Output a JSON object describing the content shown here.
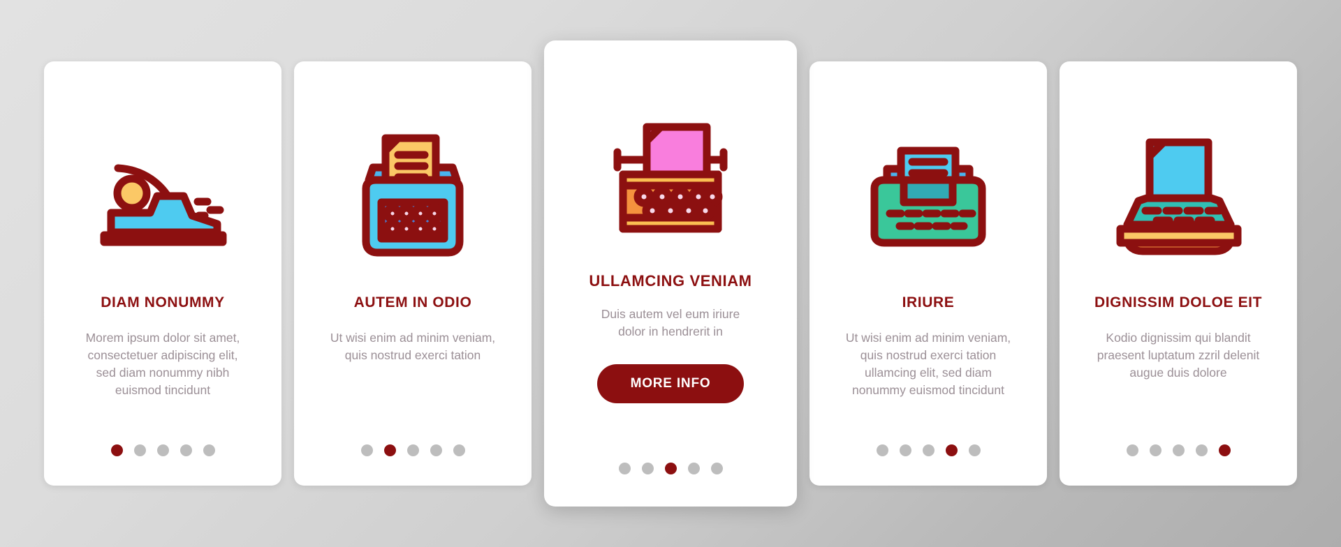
{
  "theme": {
    "accent": "#8c0f10",
    "card_background": "#ffffff",
    "body_text": "#9b8f96",
    "dot_inactive": "#bdbdbd",
    "dot_active": "#8c0f10",
    "background_light": "#e2e2e2",
    "background_dark": "#adadad"
  },
  "carousel": {
    "total_slides": 5,
    "cards": [
      {
        "icon_name": "typewriter-carriage-icon",
        "title": "DIAM NONUMMY",
        "body": "Morem ipsum dolor sit amet, consectetuer adipiscing elit, sed diam nonummy nibh euismod tincidunt",
        "active_dot": 1,
        "featured": false,
        "button_label": ""
      },
      {
        "icon_name": "typewriter-paper-keys-icon",
        "title": "AUTEM IN ODIO",
        "body": "Ut wisi enim ad minim veniam, quis nostrud exerci tation",
        "active_dot": 2,
        "featured": false,
        "button_label": ""
      },
      {
        "icon_name": "typewriter-pink-paper-icon",
        "title": "ULLAMCING VENIAM",
        "body": "Duis autem vel eum iriure dolor in hendrerit in",
        "active_dot": 3,
        "featured": true,
        "button_label": "MORE INFO"
      },
      {
        "icon_name": "typewriter-green-icon",
        "title": "IRIURE",
        "body": "Ut wisi enim ad minim veniam, quis nostrud exerci tation ullamcing elit, sed diam nonummy euismod tincidunt",
        "active_dot": 4,
        "featured": false,
        "button_label": ""
      },
      {
        "icon_name": "typewriter-orange-icon",
        "title": "DIGNISSIM DOLOE EIT",
        "body": "Kodio dignissim qui blandit praesent luptatum zzril delenit augue duis dolore",
        "active_dot": 5,
        "featured": false,
        "button_label": ""
      }
    ]
  },
  "icon_palette": {
    "outline": "#8c1010",
    "cyan": "#4ecbf0",
    "blue": "#4a7fd4",
    "yellow": "#fbc866",
    "pink": "#f97edd",
    "orange": "#f5923e",
    "light_orange": "#f9a86a",
    "green": "#3ac79a",
    "teal": "#31bfb4",
    "key_center": "#f7d8ea",
    "amber": "#fbbe52"
  }
}
